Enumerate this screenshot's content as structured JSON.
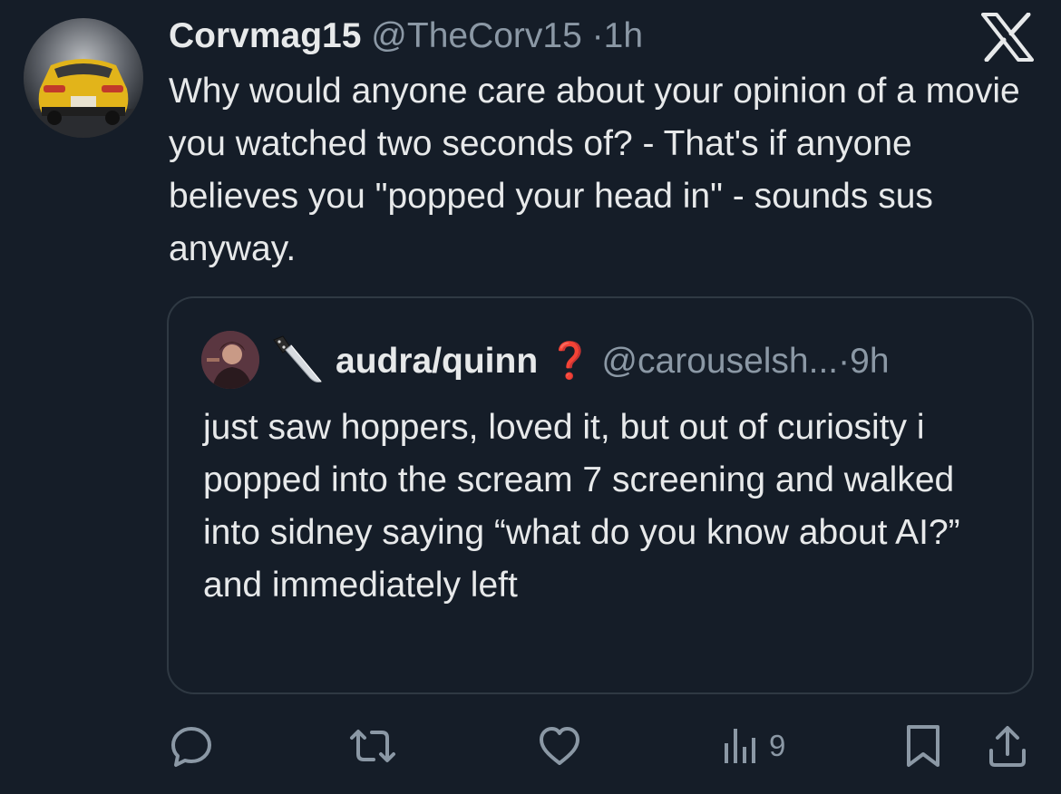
{
  "tweet": {
    "author_name": "Corvmag15",
    "author_handle": "@TheCorv15",
    "separator": "·",
    "time": "1h",
    "text": "Why would anyone care about your opinion of a movie you watched two seconds of? - That's if anyone believes you \"popped your head in\" - sounds sus anyway."
  },
  "quote": {
    "author_name": "audra/quinn",
    "author_mark": "❓",
    "author_handle": "@carouselsh...",
    "separator": "·",
    "time": "9h",
    "text": "just saw hoppers, loved it, but out of curiosity i popped into the scream 7 screening and walked into sidney saying “what do you know about AI?” and immediately left"
  },
  "actions": {
    "views_count": "9"
  },
  "icons": {
    "logo": "x-logo-icon",
    "knife": "knife-icon",
    "reply": "reply-icon",
    "retweet": "retweet-icon",
    "like": "heart-icon",
    "views": "views-icon",
    "bookmark": "bookmark-icon",
    "share": "share-icon"
  },
  "colors": {
    "background": "#151d28",
    "text": "#e7e9ea",
    "muted": "#8b98a5",
    "border": "#2f3943"
  }
}
